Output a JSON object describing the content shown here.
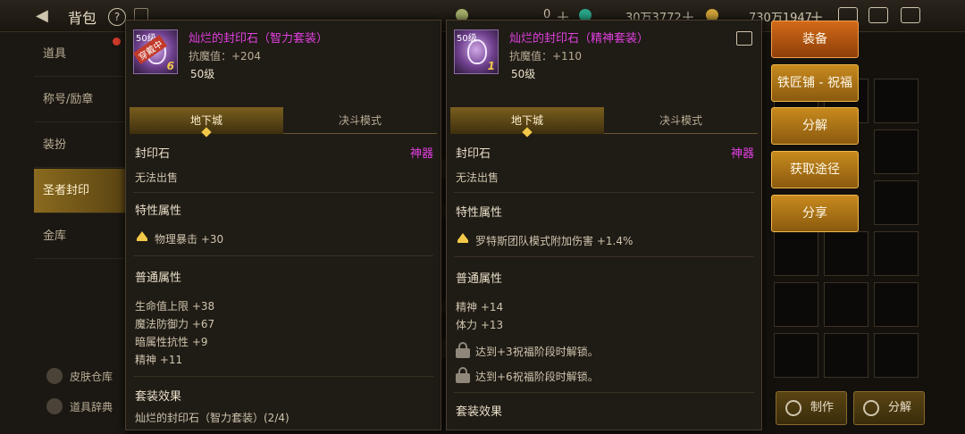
{
  "topbar": {
    "title": "背包",
    "help": "?",
    "currencies": [
      {
        "value": "0",
        "color": "#a6b06a"
      },
      {
        "value": "30万3772",
        "color": "#2aa88a"
      },
      {
        "value": "730万1947",
        "color": "#d4a53a"
      }
    ]
  },
  "sidebar": {
    "items": [
      "道具",
      "称号/励章",
      "装扮",
      "圣者封印",
      "金库"
    ],
    "active_index": 3,
    "footer": [
      "皮肤仓库",
      "道具辞典"
    ]
  },
  "panel_left": {
    "level_tag": "50级",
    "equipped_tag": "穿戴中",
    "stack": "6",
    "name": "灿烂的封印石（智力套装）",
    "resist": "抗魔值：+204",
    "level": "50级",
    "tabs": [
      "地下城",
      "决斗模式"
    ],
    "category": "封印石",
    "tier": "神器",
    "sell": "无法出售",
    "special_title": "特性属性",
    "special": "物理暴击 +30",
    "normal_title": "普通属性",
    "normal": [
      "生命值上限 +38",
      "魔法防御力 +67",
      "暗属性抗性 +9",
      "精神 +11"
    ],
    "set_title": "套装效果",
    "set_name": "灿烂的封印石（智力套装）(2/4)"
  },
  "panel_right": {
    "level_tag": "50级",
    "stack": "1",
    "name": "灿烂的封印石（精神套装）",
    "resist": "抗魔值：+110",
    "level": "50级",
    "tabs": [
      "地下城",
      "决斗模式"
    ],
    "category": "封印石",
    "tier": "神器",
    "sell": "无法出售",
    "special_title": "特性属性",
    "special": "罗特斯团队模式附加伤害 +1.4%",
    "normal_title": "普通属性",
    "normal": [
      "精神 +14",
      "体力 +13"
    ],
    "locked": [
      "达到+3祝福阶段时解锁。",
      "达到+6祝福阶段时解锁。"
    ],
    "set_title": "套装效果"
  },
  "actions": [
    "装备",
    "铁匠铺 - 祝福",
    "分解",
    "获取途径",
    "分享"
  ],
  "bottom": [
    "制作",
    "分解"
  ]
}
